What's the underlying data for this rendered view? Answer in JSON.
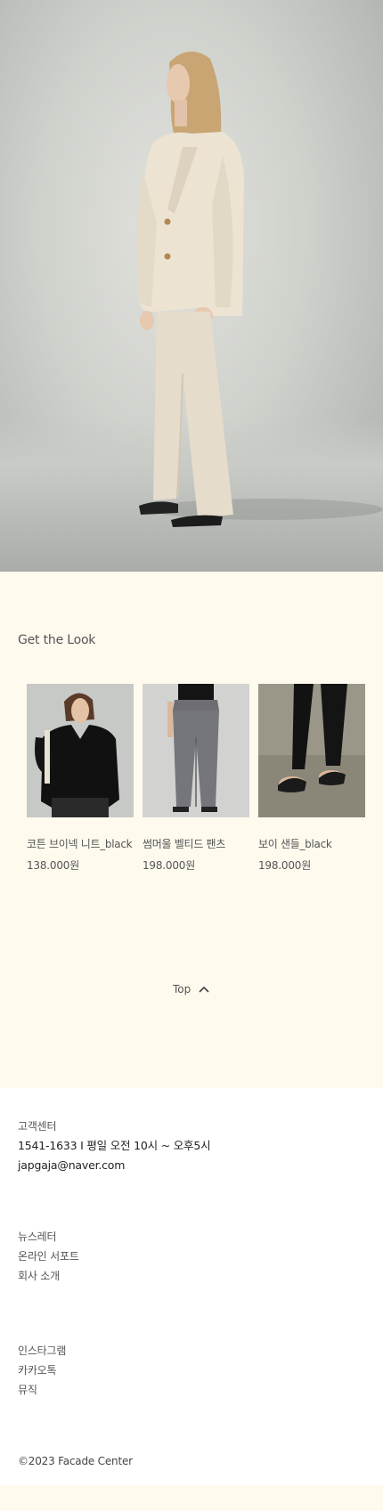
{
  "hero": {
    "alt": "model in beige linen suit"
  },
  "get_the_look": {
    "title": "Get the Look",
    "products": [
      {
        "name": "코튼 브이넥 니트_black",
        "price": "138.000원"
      },
      {
        "name": "썸머울 벨티드 팬츠",
        "price": "198.000원"
      },
      {
        "name": "보이 샌들_black",
        "price": "198.000원"
      }
    ]
  },
  "top_button": {
    "label": "Top",
    "icon": "chevron-up-icon"
  },
  "footer": {
    "customer_center": {
      "title": "고객센터",
      "phone_hours": "1541-1633 I 평일 오전 10시 ~ 오후5시",
      "email": "japgaja@naver.com"
    },
    "links_1": [
      "뉴스레터",
      "온라인 서포트",
      "회사 소개"
    ],
    "links_2": [
      "인스타그램",
      "카카오톡",
      "뮤직"
    ],
    "copyright": "©2023 Facade Center"
  },
  "colors": {
    "page_bg": "#fffaee",
    "footer_bg": "#ffffff",
    "text": "#555555"
  }
}
